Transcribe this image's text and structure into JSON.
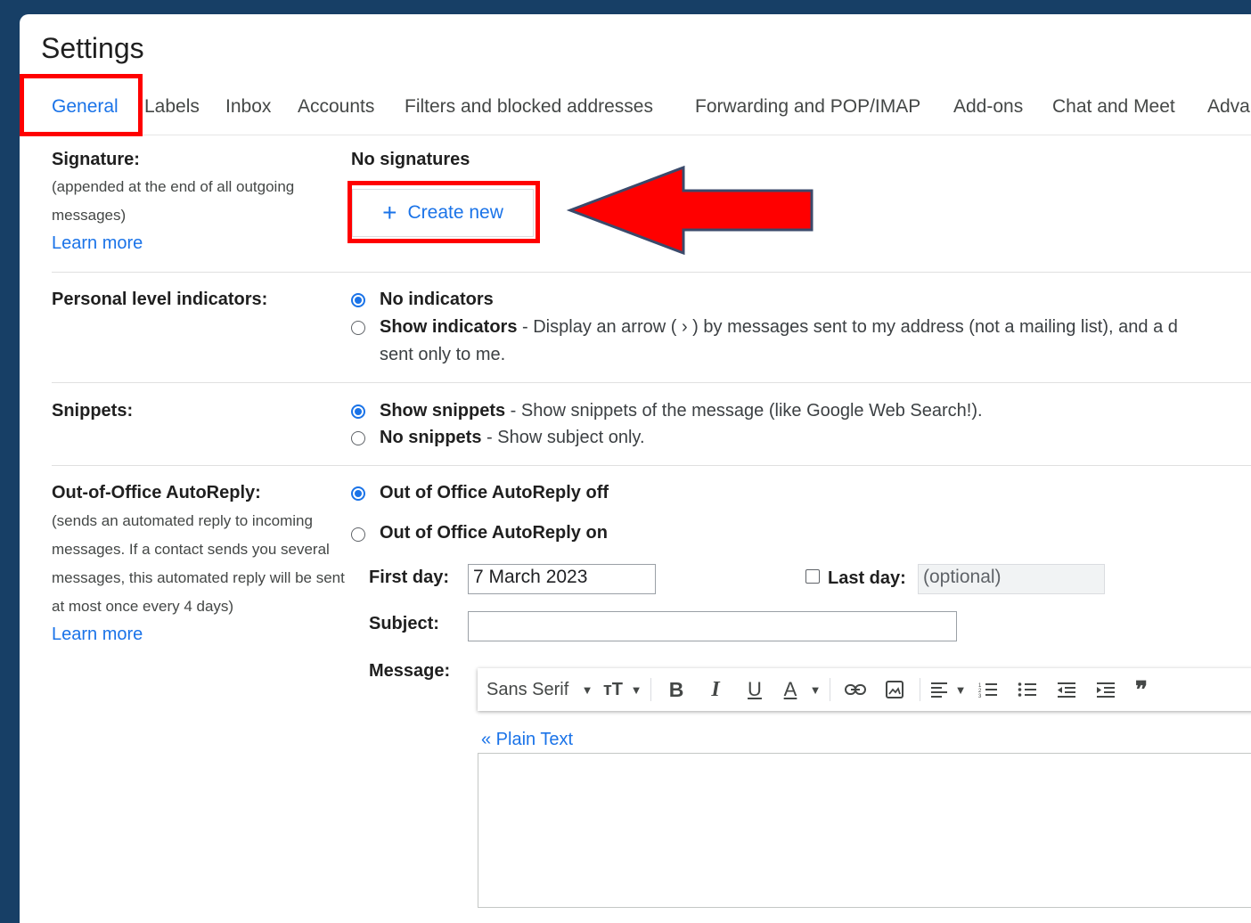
{
  "page": {
    "title": "Settings"
  },
  "tabs": [
    {
      "label": "General",
      "active": true
    },
    {
      "label": "Labels"
    },
    {
      "label": "Inbox"
    },
    {
      "label": "Accounts"
    },
    {
      "label": "Filters and blocked addresses"
    },
    {
      "label": "Forwarding and POP/IMAP"
    },
    {
      "label": "Add-ons"
    },
    {
      "label": "Chat and Meet"
    },
    {
      "label": "Adva"
    }
  ],
  "signature": {
    "label": "Signature:",
    "description": "(appended at the end of all outgoing messages)",
    "learn_more": "Learn more",
    "status": "No signatures",
    "create_label": "Create new"
  },
  "personal_level": {
    "label": "Personal level indicators:",
    "option1": "No indicators",
    "option2_bold": "Show indicators",
    "option2_rest": " - Display an arrow ( › ) by messages sent to my address (not a mailing list), and a d",
    "option2_line2": "sent only to me.",
    "selected": "No indicators"
  },
  "snippets": {
    "label": "Snippets:",
    "option1_bold": "Show snippets",
    "option1_rest": " - Show snippets of the message (like Google Web Search!).",
    "option2_bold": "No snippets",
    "option2_rest": " - Show subject only.",
    "selected": "Show snippets"
  },
  "autoreply": {
    "label": "Out-of-Office AutoReply:",
    "description": "(sends an automated reply to incoming messages. If a contact sends you several messages, this automated reply will be sent at most once every 4 days)",
    "learn_more": "Learn more",
    "option_off": "Out of Office AutoReply off",
    "option_on": "Out of Office AutoReply on",
    "selected": "Out of Office AutoReply off",
    "first_day_label": "First day:",
    "first_day_value": "7 March 2023",
    "last_day_label": "Last day:",
    "last_day_placeholder": "(optional)",
    "subject_label": "Subject:",
    "subject_value": "",
    "message_label": "Message:",
    "plain_text_link": "« Plain Text"
  },
  "toolbar": {
    "font": "Sans Serif",
    "size_glyph": "тT",
    "bold": "B",
    "italic": "I",
    "underline": "U",
    "text_color": "A",
    "quote": "❞"
  },
  "colors": {
    "accent": "#1a73e8",
    "highlight": "#ff0000",
    "background": "#173f66"
  }
}
